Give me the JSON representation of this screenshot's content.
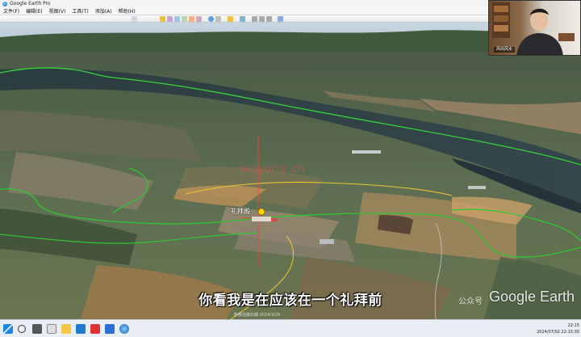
{
  "window": {
    "title": "Google Earth Pro"
  },
  "menu": [
    {
      "id": "file",
      "label": "文件(F)"
    },
    {
      "id": "edit",
      "label": "编辑(E)"
    },
    {
      "id": "view",
      "label": "视图(V)"
    },
    {
      "id": "tools",
      "label": "工具(T)"
    },
    {
      "id": "add",
      "label": "添加(A)"
    },
    {
      "id": "help",
      "label": "帮助(H)"
    }
  ],
  "view": {
    "site_watermark": "wuyona.cn",
    "place_label": "礼拜殿",
    "status_text": "影像拍摄日期 2024/3/29",
    "subtitle": "你看我是在应该在一个礼拜前",
    "watermark": "公众号",
    "ge_logo": "Google Earth"
  },
  "webcam": {
    "name": "风尚风水"
  },
  "taskbar": {
    "clock_time": "22:15",
    "clock_date": "2024/07/02 22:15:30"
  }
}
